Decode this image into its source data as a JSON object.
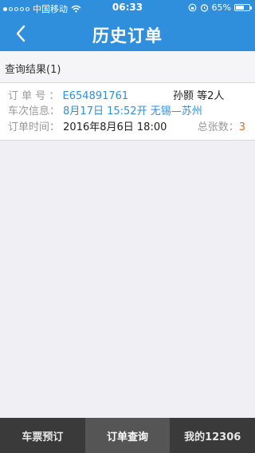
{
  "status_bar": {
    "carrier": "中国移动",
    "time": "06:33",
    "battery_percent": "65%",
    "signal_dots_filled": 1,
    "signal_dots_total": 5,
    "battery_level": 0.65,
    "icons": [
      "wifi-icon",
      "rotation-lock-icon",
      "alarm-icon",
      "battery-icon"
    ]
  },
  "nav": {
    "title": "历史订单",
    "back_icon": "chevron-left-icon"
  },
  "results": {
    "label": "查询结果(1)"
  },
  "order": {
    "order_no_label": "订 单 号 ：",
    "order_no": "E654891761",
    "passengers": "孙颢 等2人",
    "train_info_label": "车次信息：",
    "train_info": "8月17日 15:52开 无锡—苏州",
    "order_time_label": "订单时间：",
    "order_time": "2016年8月6日 18:00",
    "ticket_count_label": "总张数：",
    "ticket_count": "3"
  },
  "tabs": [
    {
      "label": "车票预订",
      "active": false
    },
    {
      "label": "订单查询",
      "active": true
    },
    {
      "label": "我的12306",
      "active": false
    }
  ],
  "colors": {
    "accent": "#2f8fdc",
    "highlight": "#e8671e",
    "tabbar": "#3a3a3a"
  }
}
